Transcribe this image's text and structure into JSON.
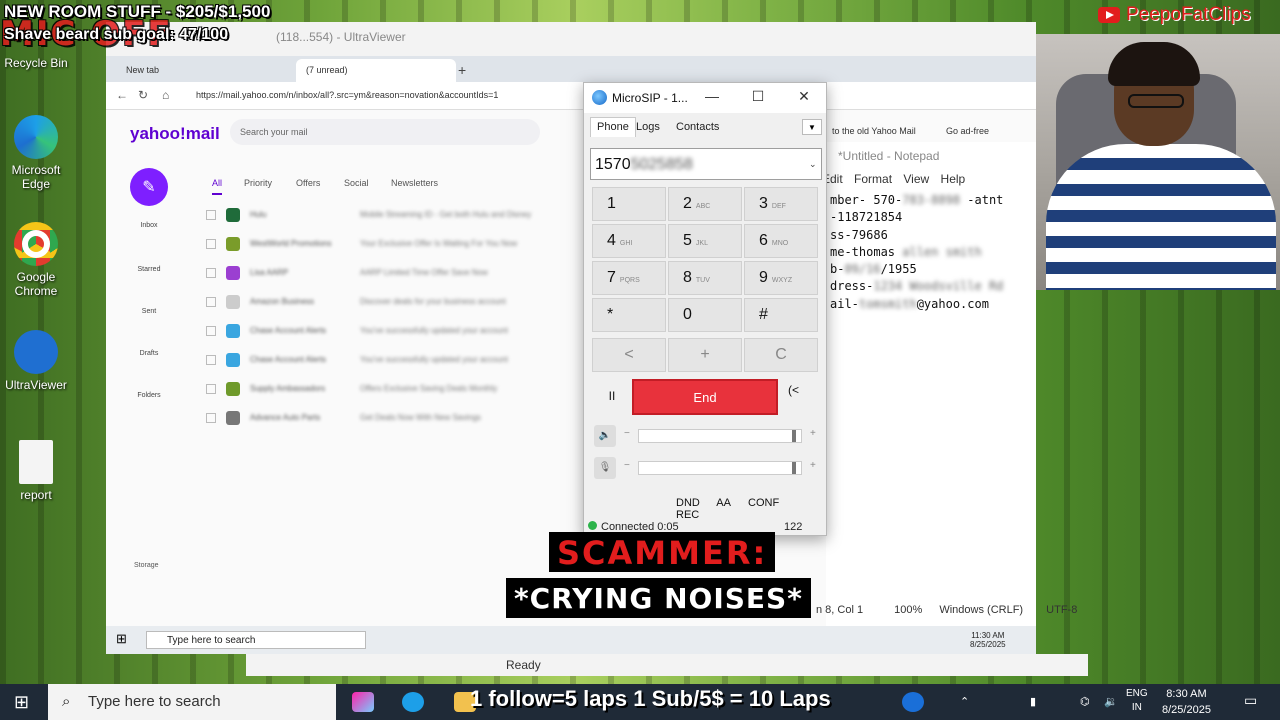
{
  "overlay": {
    "room_goal": "NEW ROOM STUFF - $205/$1,500",
    "beard_goal": "Shave beard sub goal: 47/100",
    "mic_text": "MIC OFF",
    "channel": "PeepoFatClips",
    "caption_line1": "SCAMMER:",
    "caption_line2": "*CRYING NOISES*",
    "taskbar_text": "1 follow=5 laps 1 Sub/5$ = 10 Laps"
  },
  "desktop_icons": [
    {
      "label": "Recycle Bin",
      "icon": "recycle-bin-icon"
    },
    {
      "label": "Microsoft Edge",
      "icon": "edge-icon"
    },
    {
      "label": "Google Chrome",
      "icon": "chrome-icon"
    },
    {
      "label": "UltraViewer",
      "icon": "ultraviewer-icon"
    },
    {
      "label": "report",
      "icon": "text-file-icon"
    }
  ],
  "remote": {
    "title": "(118...554) - UltraViewer",
    "tabs": [
      "New tab",
      "(7 unread)"
    ],
    "url": "https://mail.yahoo.com/n/inbox/all?.src=ym&reason=novation&accountIds=1",
    "yahoo": {
      "logo": "yahoo!mail",
      "search_placeholder": "Search your mail",
      "back_old": "to the old Yahoo Mail",
      "ad_free": "Go ad-free",
      "mail_tabs": [
        "All",
        "Priority",
        "Offers",
        "Social",
        "Newsletters"
      ],
      "nav": [
        "Inbox",
        "Starred",
        "Sent",
        "Drafts",
        "Folders",
        "Storage"
      ],
      "rows": [
        {
          "sender": "Hulu",
          "subject": "Mobile Streaming ID - Get both Hulu and Disney",
          "color": "#1f6b3a"
        },
        {
          "sender": "WestWorld Promotions",
          "subject": "Your Exclusive Offer Is Waiting For You Now",
          "color": "#7a9c2a"
        },
        {
          "sender": "Lisa AARP",
          "subject": "AARP Limited Time Offer Save Now",
          "color": "#9b3fd1"
        },
        {
          "sender": "Amazon Business",
          "subject": "Discover deals for your business account",
          "color": "#cccccc"
        },
        {
          "sender": "Chase Account Alerts",
          "subject": "You've successfully updated your account",
          "color": "#3aa6e0"
        },
        {
          "sender": "Chase Account Alerts",
          "subject": "You've successfully updated your account",
          "color": "#3aa6e0"
        },
        {
          "sender": "Supply Ambassadors",
          "subject": "Offers Exclusive Saving Deals Monthly",
          "color": "#6f9a2b"
        },
        {
          "sender": "Advance Auto Parts",
          "subject": "Get Deals Now With New Savings",
          "color": "#777777"
        }
      ]
    },
    "notepad": {
      "title": "*Untitled - Notepad",
      "menu": [
        "Edit",
        "Format",
        "View",
        "Help"
      ],
      "lines": [
        {
          "text": "mber- 570-",
          "blur": "783-8898",
          "rest": " -atnt"
        },
        {
          "text": "-118721854",
          "blur": "",
          "rest": ""
        },
        {
          "text": "ss-79686",
          "blur": "",
          "rest": ""
        },
        {
          "text": "me-thomas ",
          "blur": "allen smith",
          "rest": ""
        },
        {
          "text": "b-",
          "blur": "09/16",
          "rest": "/1955"
        },
        {
          "text": "dress-",
          "blur": "1234 Woodsville Rd",
          "rest": ""
        },
        {
          "text": "ail-",
          "blur": "tomsmith",
          "rest": "@yahoo.com"
        }
      ],
      "status_pos": "n 8, Col 1",
      "status_zoom": "100%",
      "status_eol": "Windows (CRLF)",
      "status_enc": "UTF-8"
    },
    "taskbar_search": "Type here to search",
    "taskbar_time": "11:30 AM",
    "taskbar_date": "8/25/2025"
  },
  "microsip": {
    "title": "MicroSIP - 1...",
    "tabs": [
      "Phone",
      "Logs",
      "Contacts"
    ],
    "number_visible": "1570",
    "number_blur": "5025858",
    "keys": [
      {
        "d": "1",
        "s": ""
      },
      {
        "d": "2",
        "s": "ABC"
      },
      {
        "d": "3",
        "s": "DEF"
      },
      {
        "d": "4",
        "s": "GHI"
      },
      {
        "d": "5",
        "s": "JKL"
      },
      {
        "d": "6",
        "s": "MNO"
      },
      {
        "d": "7",
        "s": "PQRS"
      },
      {
        "d": "8",
        "s": "TUV"
      },
      {
        "d": "9",
        "s": "WXYZ"
      },
      {
        "d": "*",
        "s": ""
      },
      {
        "d": "0",
        "s": ""
      },
      {
        "d": "#",
        "s": ""
      }
    ],
    "row_back": "<",
    "row_plus": "+",
    "row_clear": "C",
    "end_label": "End",
    "hold_label": "II",
    "transfer_label": "(<",
    "speaker_volume": 0.97,
    "mic_volume": 0.97,
    "bottom_buttons": [
      "DND",
      "AA",
      "CONF",
      "REC"
    ],
    "status": "Connected 0:05",
    "status_count": "122"
  },
  "ultraviewer_status": "Ready",
  "taskbar": {
    "search_placeholder": "Type here to search",
    "lang_1": "ENG",
    "lang_2": "IN",
    "time": "8:30 AM",
    "date": "8/25/2025"
  }
}
